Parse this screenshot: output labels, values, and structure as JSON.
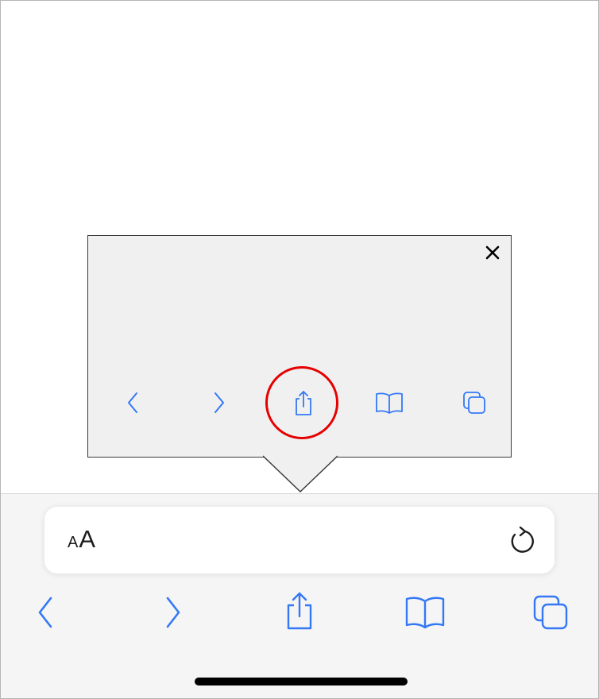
{
  "colors": {
    "accent": "#3478f6",
    "highlight": "#e60000",
    "toolbar_bg": "#f5f5f5",
    "callout_bg": "#f0f0f0"
  },
  "callout": {
    "close_icon": "close-icon",
    "buttons": [
      {
        "name": "back",
        "icon": "chevron-left-icon"
      },
      {
        "name": "forward",
        "icon": "chevron-right-icon"
      },
      {
        "name": "share",
        "icon": "share-icon",
        "highlighted": true
      },
      {
        "name": "bookmarks",
        "icon": "book-icon"
      },
      {
        "name": "tabs",
        "icon": "tabs-icon"
      }
    ]
  },
  "address_bar": {
    "aa_small": "A",
    "aa_large": "A",
    "reload_icon": "reload-icon"
  },
  "toolbar": {
    "buttons": [
      {
        "name": "back",
        "icon": "chevron-left-icon"
      },
      {
        "name": "forward",
        "icon": "chevron-right-icon"
      },
      {
        "name": "share",
        "icon": "share-icon"
      },
      {
        "name": "bookmarks",
        "icon": "book-icon"
      },
      {
        "name": "tabs",
        "icon": "tabs-icon"
      }
    ]
  }
}
